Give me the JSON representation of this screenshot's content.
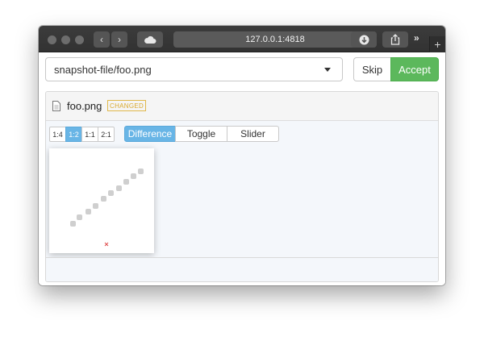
{
  "browser": {
    "url": "127.0.0.1:4818",
    "icons": [
      "back-icon",
      "forward-icon",
      "cloud-icon",
      "reload-icon",
      "download-icon",
      "share-icon",
      "overflow-icon",
      "new-tab-icon"
    ]
  },
  "toolbar": {
    "file_select_value": "snapshot-file/foo.png",
    "skip_label": "Skip",
    "accept_label": "Accept"
  },
  "file": {
    "name": "foo.png",
    "status": "CHANGED"
  },
  "zoom": {
    "options": [
      "1:4",
      "1:2",
      "1:1",
      "2:1"
    ],
    "selected": "1:2"
  },
  "view_modes": {
    "options": [
      "Difference",
      "Toggle",
      "Slider"
    ],
    "selected": "Difference"
  },
  "colors": {
    "accent_blue": "#68b5e6",
    "accept_green": "#5cb85c",
    "badge_gold": "#d9a92e",
    "diff_dot_gray": "#cfcfcf",
    "diff_mark_red": "#e05050"
  }
}
